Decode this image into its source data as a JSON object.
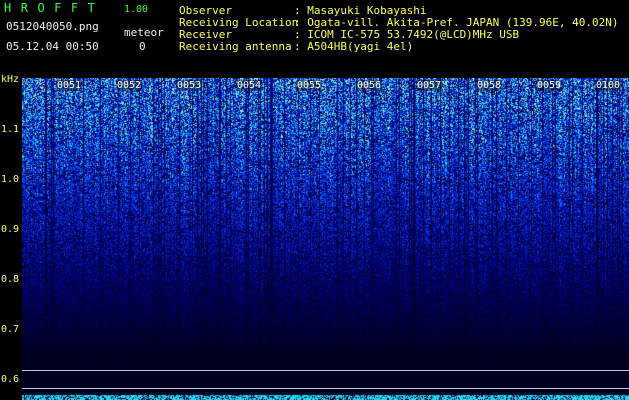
{
  "header": {
    "brand": "HROFFT",
    "version": "1.00",
    "filename": "0512040050.png",
    "datetime": "05.12.04 00:50",
    "meteor_label": "meteor",
    "meteor_count": "0",
    "fields": [
      {
        "label": "Observer",
        "value": ": Masayuki Kobayashi"
      },
      {
        "label": "Receiving Location",
        "value": ": Ogata-vill. Akita-Pref. JAPAN (139.96E, 40.02N)"
      },
      {
        "label": "Receiver",
        "value": ": ICOM IC-575 53.7492(@LCD)MHz USB"
      },
      {
        "label": "Receiving antenna",
        "value": ": A504HB(yagi 4el)"
      }
    ]
  },
  "axis": {
    "unit": "kHz",
    "ticks": [
      "1.1",
      "1.0",
      "0.9",
      "0.8",
      "0.7",
      "0.6"
    ]
  },
  "time_labels": [
    "0051",
    "0052",
    "0053",
    "0054",
    "0055",
    "0056",
    "0057",
    "0058",
    "0059",
    "0100"
  ],
  "colors": {
    "background": "#000000",
    "label_yellow": "#ffff55",
    "label_green": "#33ff33",
    "noise_floor": "#00e5ff"
  }
}
